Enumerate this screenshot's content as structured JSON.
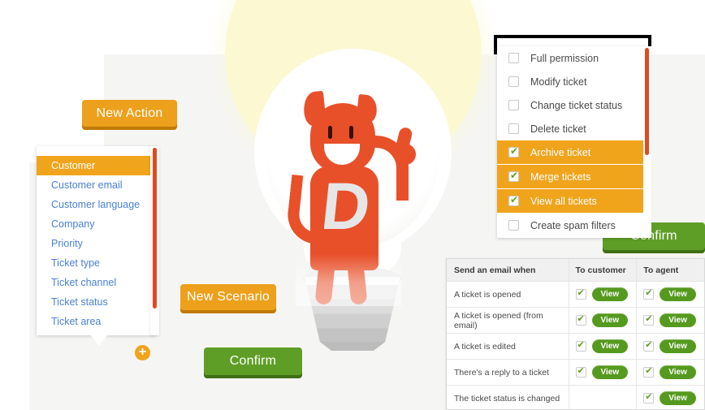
{
  "buttons": {
    "new_action": "New Action",
    "new_scenario": "New Scenario",
    "confirm_left": "Confirm",
    "confirm_right": "Confirm",
    "add_icon": "+"
  },
  "field_dropdown": {
    "items": [
      {
        "label": "Customer",
        "selected": true
      },
      {
        "label": "Customer email",
        "selected": false
      },
      {
        "label": "Customer language",
        "selected": false
      },
      {
        "label": "Company",
        "selected": false
      },
      {
        "label": "Priority",
        "selected": false
      },
      {
        "label": "Ticket type",
        "selected": false
      },
      {
        "label": "Ticket channel",
        "selected": false
      },
      {
        "label": "Ticket status",
        "selected": false
      },
      {
        "label": "Ticket area",
        "selected": false
      }
    ]
  },
  "permissions_panel": {
    "items": [
      {
        "label": "Full permission",
        "checked": false
      },
      {
        "label": "Modify ticket",
        "checked": false
      },
      {
        "label": "Change ticket status",
        "checked": false
      },
      {
        "label": "Delete ticket",
        "checked": false
      },
      {
        "label": "Archive ticket",
        "checked": true
      },
      {
        "label": "Merge tickets",
        "checked": true
      },
      {
        "label": "View all tickets",
        "checked": true
      },
      {
        "label": "Create spam filters",
        "checked": false
      }
    ]
  },
  "email_table": {
    "headers": [
      "Send an email when",
      "To customer",
      "To agent"
    ],
    "view_label": "View",
    "rows": [
      {
        "event": "A ticket is opened",
        "to_customer": true,
        "to_agent": true
      },
      {
        "event": "A ticket is opened (from email)",
        "to_customer": true,
        "to_agent": true
      },
      {
        "event": "A ticket is edited",
        "to_customer": true,
        "to_agent": true
      },
      {
        "event": "There's a reply to a ticket",
        "to_customer": true,
        "to_agent": true
      },
      {
        "event": "The ticket status is changed",
        "to_customer": null,
        "to_agent": true
      }
    ]
  },
  "colors": {
    "orange": "#eda01b",
    "orange_highlight": "#f0a41c",
    "green": "#5f9e26",
    "green_button": "#559a1e",
    "mascot_red": "#e8502a",
    "scrollbar_red": "#e2491f",
    "link_blue": "#4a7fd6",
    "glow_yellow": "#fcf8d2",
    "panel_gray": "#f5f5f4"
  },
  "illustration": {
    "name": "mascot-in-lightbulb",
    "chest_logo": "D"
  }
}
